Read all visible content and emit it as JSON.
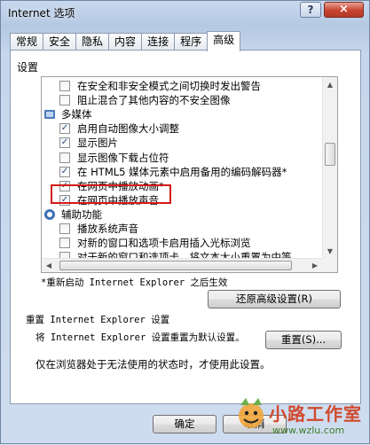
{
  "window": {
    "title": "Internet 选项",
    "help": "?",
    "close": "×"
  },
  "tabs": [
    "常规",
    "安全",
    "隐私",
    "内容",
    "连接",
    "程序",
    "高级"
  ],
  "active_tab": "高级",
  "settings_group_label": "设置",
  "settings_rows": [
    {
      "type": "check",
      "checked": false,
      "label": "在安全和非安全模式之间切换时发出警告"
    },
    {
      "type": "check",
      "checked": false,
      "label": "阻止混合了其他内容的不安全图像"
    },
    {
      "type": "category",
      "icon": "multimedia-icon",
      "label": "多媒体"
    },
    {
      "type": "check",
      "checked": true,
      "label": "启用自动图像大小调整"
    },
    {
      "type": "check",
      "checked": true,
      "label": "显示图片"
    },
    {
      "type": "check",
      "checked": false,
      "label": "显示图像下载占位符"
    },
    {
      "type": "check",
      "checked": true,
      "label": "在 HTML5 媒体元素中启用备用的编码解码器*"
    },
    {
      "type": "check",
      "checked": true,
      "label": "在网页中播放动画*"
    },
    {
      "type": "check",
      "checked": true,
      "label": "在网页中播放声音"
    },
    {
      "type": "category",
      "icon": "accessibility-icon",
      "label": "辅助功能"
    },
    {
      "type": "check",
      "checked": false,
      "label": "播放系统声音"
    },
    {
      "type": "check",
      "checked": false,
      "label": "对新的窗口和选项卡启用插入光标浏览"
    },
    {
      "type": "check",
      "checked": false,
      "label": "对于新的窗口和选项卡，将文本大小重置为中等"
    }
  ],
  "restart_note": "*重新启动 Internet Explorer 之后生效",
  "restore_button": "还原高级设置(R)",
  "reset_section": {
    "title": "重置 Internet Explorer 设置",
    "description": "将 Internet Explorer 设置重置为默认设置。",
    "button": "重置(S)...",
    "note": "仅在浏览器处于无法使用的状态时，才使用此设置。"
  },
  "footer": {
    "ok": "确定",
    "cancel": "取消"
  },
  "watermark": {
    "text": "小路工作室",
    "url": "www.wzlu.com"
  },
  "colors": {
    "highlight": "#d21a1a",
    "checkmark": "#2c4a7a"
  }
}
